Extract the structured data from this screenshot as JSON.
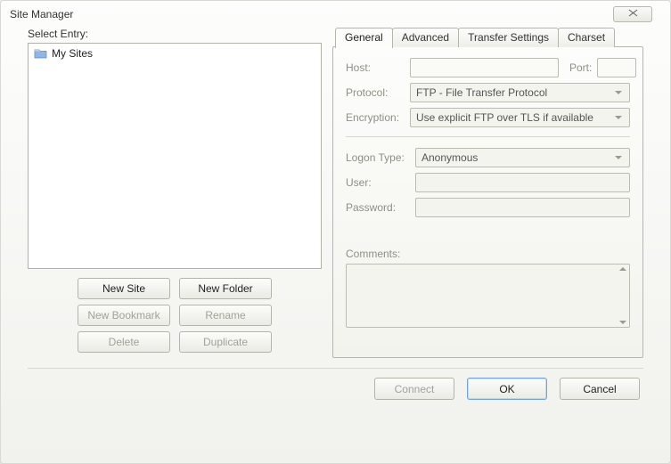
{
  "window": {
    "title": "Site Manager"
  },
  "left": {
    "select_entry_label": "Select Entry:",
    "tree": {
      "root_label": "My Sites"
    },
    "buttons": {
      "new_site": "New Site",
      "new_folder": "New Folder",
      "new_bookmark": "New Bookmark",
      "rename": "Rename",
      "delete": "Delete",
      "duplicate": "Duplicate"
    }
  },
  "tabs": {
    "general": "General",
    "advanced": "Advanced",
    "transfer": "Transfer Settings",
    "charset": "Charset"
  },
  "general": {
    "host_label": "Host:",
    "port_label": "Port:",
    "protocol_label": "Protocol:",
    "protocol_value": "FTP - File Transfer Protocol",
    "encryption_label": "Encryption:",
    "encryption_value": "Use explicit FTP over TLS if available",
    "logon_type_label": "Logon Type:",
    "logon_type_value": "Anonymous",
    "user_label": "User:",
    "password_label": "Password:",
    "comments_label": "Comments:"
  },
  "footer": {
    "connect": "Connect",
    "ok": "OK",
    "cancel": "Cancel"
  }
}
